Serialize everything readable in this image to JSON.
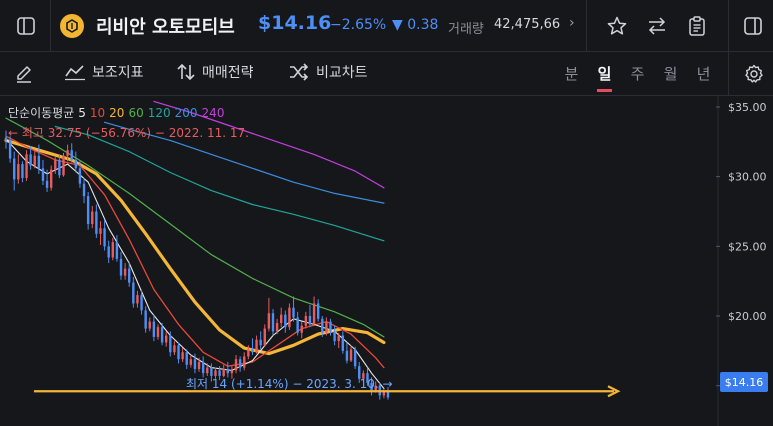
{
  "header": {
    "stock_name": "리비안 오토모티브",
    "price": "$14.16",
    "change_percent": "−2.65%",
    "change_amount": "▼ 0.38",
    "volume_label": "거래량",
    "volume_value": "42,475,66",
    "more_icon": "chevron-right-icon",
    "icons": [
      "sidebar-toggle-icon",
      "star-icon",
      "swap-icon",
      "clipboard-icon",
      "panel-right-icon"
    ]
  },
  "toolbar": {
    "indicator_label": "보조지표",
    "strategy_label": "매매전략",
    "compare_label": "비교차트",
    "periods": [
      "분",
      "일",
      "주",
      "월",
      "년"
    ],
    "active_period": "일"
  },
  "chart_data": {
    "type": "candlestick",
    "y_axis": {
      "ticks": [
        "$35.00",
        "$30.00",
        "$25.00",
        "$20.00",
        "$15.00"
      ],
      "range": [
        13.4,
        35.5
      ]
    },
    "moving_average_legend": {
      "label": "단순이동평균",
      "periods": [
        {
          "value": "5",
          "color": "#e8e8e8"
        },
        {
          "value": "10",
          "color": "#e8493b"
        },
        {
          "value": "20",
          "color": "#f5b637"
        },
        {
          "value": "60",
          "color": "#51b24a"
        },
        {
          "value": "120",
          "color": "#1fa59a"
        },
        {
          "value": "200",
          "color": "#3b8ee0"
        },
        {
          "value": "240",
          "color": "#c43ee0"
        }
      ]
    },
    "high_annotation": "← 최고 32.75 (−56.76%) − 2022. 11. 17.",
    "low_annotation": "최저 14 (+1.14%) − 2023. 3. 10. →",
    "current_price_tag": "$14.16",
    "reference_line_price": 14.6,
    "colors": {
      "up": "#e85c5c",
      "down": "#4d8ff7",
      "reference": "#f5b637"
    },
    "candles_note": "approximate daily OHLC (oldest → newest)",
    "candles": [
      [
        32.8,
        33.3,
        32.0,
        32.6
      ],
      [
        32.6,
        32.9,
        31.0,
        31.3
      ],
      [
        31.3,
        31.8,
        29.0,
        29.8
      ],
      [
        29.8,
        31.6,
        29.5,
        30.9
      ],
      [
        30.9,
        31.1,
        29.6,
        29.9
      ],
      [
        29.9,
        31.9,
        29.7,
        31.6
      ],
      [
        31.6,
        32.2,
        30.5,
        30.8
      ],
      [
        30.8,
        31.9,
        30.6,
        31.5
      ],
      [
        31.5,
        32.3,
        30.2,
        30.6
      ],
      [
        30.6,
        31.2,
        29.4,
        29.7
      ],
      [
        29.7,
        30.5,
        28.9,
        29.2
      ],
      [
        29.2,
        30.8,
        29.0,
        30.5
      ],
      [
        30.5,
        31.4,
        30.2,
        31.2
      ],
      [
        31.2,
        31.6,
        29.9,
        30.1
      ],
      [
        30.1,
        31.7,
        30.0,
        31.5
      ],
      [
        31.5,
        32.3,
        31.1,
        31.9
      ],
      [
        31.9,
        32.4,
        31.0,
        31.2
      ],
      [
        31.2,
        31.8,
        30.3,
        30.6
      ],
      [
        30.6,
        31.1,
        29.2,
        29.5
      ],
      [
        29.5,
        29.9,
        28.1,
        28.6
      ],
      [
        28.6,
        28.9,
        26.2,
        26.6
      ],
      [
        26.6,
        27.9,
        26.3,
        27.5
      ],
      [
        27.5,
        28.0,
        25.6,
        25.9
      ],
      [
        25.9,
        26.8,
        25.1,
        26.3
      ],
      [
        26.3,
        26.9,
        24.7,
        25.0
      ],
      [
        25.0,
        25.4,
        23.8,
        24.2
      ],
      [
        24.2,
        25.6,
        24.0,
        25.3
      ],
      [
        25.3,
        25.8,
        23.9,
        24.1
      ],
      [
        24.1,
        24.6,
        22.6,
        22.9
      ],
      [
        22.9,
        23.8,
        22.6,
        23.4
      ],
      [
        23.4,
        23.9,
        22.1,
        22.4
      ],
      [
        22.4,
        22.8,
        20.6,
        20.9
      ],
      [
        20.9,
        21.8,
        20.6,
        21.5
      ],
      [
        21.5,
        21.9,
        20.1,
        20.4
      ],
      [
        20.4,
        20.7,
        18.8,
        19.1
      ],
      [
        19.1,
        19.9,
        18.9,
        19.6
      ],
      [
        19.6,
        20.1,
        18.2,
        18.5
      ],
      [
        18.5,
        19.4,
        18.3,
        19.2
      ],
      [
        19.2,
        19.5,
        17.9,
        18.1
      ],
      [
        18.1,
        18.9,
        17.8,
        18.6
      ],
      [
        18.6,
        18.9,
        17.1,
        17.4
      ],
      [
        17.4,
        18.2,
        17.2,
        17.9
      ],
      [
        17.9,
        18.1,
        16.6,
        16.9
      ],
      [
        16.9,
        17.7,
        16.7,
        17.4
      ],
      [
        17.4,
        17.6,
        16.2,
        16.5
      ],
      [
        16.5,
        17.2,
        16.3,
        16.9
      ],
      [
        16.9,
        17.3,
        15.9,
        16.2
      ],
      [
        16.2,
        17.0,
        16.0,
        16.7
      ],
      [
        16.7,
        17.1,
        15.6,
        15.9
      ],
      [
        15.9,
        16.6,
        15.7,
        16.3
      ],
      [
        16.3,
        16.6,
        15.3,
        15.7
      ],
      [
        15.7,
        16.3,
        15.5,
        16.1
      ],
      [
        16.1,
        16.4,
        15.4,
        15.7
      ],
      [
        15.7,
        16.5,
        15.6,
        16.2
      ],
      [
        16.2,
        16.7,
        15.6,
        15.9
      ],
      [
        15.9,
        16.4,
        15.5,
        16.1
      ],
      [
        16.1,
        17.2,
        15.9,
        16.9
      ],
      [
        16.9,
        17.1,
        16.0,
        16.3
      ],
      [
        16.3,
        17.4,
        16.1,
        17.1
      ],
      [
        17.1,
        17.9,
        16.9,
        17.6
      ],
      [
        17.6,
        18.4,
        17.2,
        17.4
      ],
      [
        17.4,
        18.6,
        17.3,
        18.3
      ],
      [
        18.3,
        18.9,
        17.6,
        17.9
      ],
      [
        17.9,
        19.4,
        17.8,
        19.1
      ],
      [
        19.1,
        21.3,
        18.9,
        20.2
      ],
      [
        20.2,
        20.5,
        18.6,
        18.9
      ],
      [
        18.9,
        19.8,
        18.7,
        19.5
      ],
      [
        19.5,
        20.6,
        19.2,
        20.1
      ],
      [
        20.1,
        20.4,
        18.8,
        19.2
      ],
      [
        19.2,
        20.9,
        19.0,
        20.6
      ],
      [
        20.6,
        21.4,
        19.6,
        19.9
      ],
      [
        19.9,
        20.3,
        18.6,
        18.8
      ],
      [
        18.8,
        19.6,
        18.4,
        19.3
      ],
      [
        19.3,
        20.3,
        19.1,
        20.0
      ],
      [
        20.0,
        20.8,
        19.2,
        19.4
      ],
      [
        19.4,
        21.4,
        19.3,
        20.9
      ],
      [
        20.9,
        21.2,
        19.6,
        19.8
      ],
      [
        19.8,
        20.0,
        18.5,
        18.8
      ],
      [
        18.8,
        19.9,
        18.6,
        19.6
      ],
      [
        19.6,
        19.8,
        18.6,
        18.9
      ],
      [
        18.9,
        19.3,
        17.9,
        18.2
      ],
      [
        18.2,
        18.8,
        17.7,
        18.6
      ],
      [
        18.6,
        18.9,
        17.3,
        17.5
      ],
      [
        17.5,
        18.1,
        16.6,
        16.8
      ],
      [
        16.8,
        17.9,
        16.7,
        17.6
      ],
      [
        17.6,
        17.8,
        16.2,
        16.4
      ],
      [
        16.4,
        16.7,
        15.2,
        15.5
      ],
      [
        15.5,
        16.1,
        15.3,
        15.9
      ],
      [
        15.9,
        16.3,
        15.0,
        15.2
      ],
      [
        15.2,
        15.6,
        14.3,
        14.6
      ],
      [
        14.6,
        15.3,
        14.5,
        15.0
      ],
      [
        15.0,
        15.2,
        14.0,
        14.3
      ],
      [
        14.3,
        14.8,
        14.1,
        14.6
      ],
      [
        14.6,
        14.9,
        14.0,
        14.16
      ]
    ],
    "ma_lines": [
      {
        "period": "20",
        "color": "#f5b637",
        "width": 3.2,
        "points": [
          [
            0,
            32.6
          ],
          [
            8,
            31.9
          ],
          [
            16,
            31.2
          ],
          [
            22,
            30.2
          ],
          [
            28,
            28.3
          ],
          [
            34,
            25.9
          ],
          [
            40,
            23.4
          ],
          [
            46,
            21.0
          ],
          [
            52,
            19.0
          ],
          [
            58,
            17.7
          ],
          [
            64,
            17.3
          ],
          [
            70,
            17.9
          ],
          [
            76,
            18.7
          ],
          [
            82,
            19.1
          ],
          [
            88,
            18.8
          ],
          [
            92,
            18.1
          ]
        ]
      },
      {
        "period": "10",
        "color": "#e8493b",
        "width": 1.3,
        "points": [
          [
            0,
            32.9
          ],
          [
            6,
            32.0
          ],
          [
            12,
            31.2
          ],
          [
            18,
            30.8
          ],
          [
            24,
            28.7
          ],
          [
            30,
            25.5
          ],
          [
            36,
            21.9
          ],
          [
            42,
            19.4
          ],
          [
            48,
            17.4
          ],
          [
            54,
            16.4
          ],
          [
            60,
            16.7
          ],
          [
            66,
            17.9
          ],
          [
            72,
            19.1
          ],
          [
            78,
            19.6
          ],
          [
            84,
            18.7
          ],
          [
            90,
            17.0
          ],
          [
            92,
            16.3
          ]
        ]
      },
      {
        "period": "5",
        "color": "#e8e8e8",
        "width": 1.1,
        "points": [
          [
            0,
            32.7
          ],
          [
            5,
            31.1
          ],
          [
            10,
            30.2
          ],
          [
            15,
            30.9
          ],
          [
            20,
            29.6
          ],
          [
            25,
            26.3
          ],
          [
            30,
            23.8
          ],
          [
            35,
            20.4
          ],
          [
            40,
            18.6
          ],
          [
            45,
            17.2
          ],
          [
            50,
            16.3
          ],
          [
            55,
            16.1
          ],
          [
            60,
            16.8
          ],
          [
            65,
            18.6
          ],
          [
            70,
            19.8
          ],
          [
            75,
            19.4
          ],
          [
            80,
            18.9
          ],
          [
            85,
            17.6
          ],
          [
            89,
            15.9
          ],
          [
            92,
            14.8
          ]
        ]
      },
      {
        "period": "60",
        "color": "#51b24a",
        "width": 1.2,
        "points": [
          [
            0,
            34.2
          ],
          [
            10,
            32.6
          ],
          [
            20,
            30.8
          ],
          [
            30,
            28.8
          ],
          [
            40,
            26.6
          ],
          [
            50,
            24.4
          ],
          [
            60,
            22.7
          ],
          [
            70,
            21.3
          ],
          [
            80,
            20.3
          ],
          [
            87,
            19.4
          ],
          [
            92,
            18.5
          ]
        ]
      },
      {
        "period": "120",
        "color": "#1fa59a",
        "width": 1.2,
        "points": [
          [
            12,
            33.6
          ],
          [
            20,
            33.0
          ],
          [
            30,
            31.8
          ],
          [
            40,
            30.3
          ],
          [
            50,
            29.0
          ],
          [
            60,
            28.0
          ],
          [
            70,
            27.3
          ],
          [
            80,
            26.5
          ],
          [
            92,
            25.4
          ]
        ]
      },
      {
        "period": "200",
        "color": "#3b8ee0",
        "width": 1.2,
        "points": [
          [
            24,
            33.9
          ],
          [
            30,
            33.4
          ],
          [
            40,
            32.6
          ],
          [
            50,
            31.6
          ],
          [
            60,
            30.6
          ],
          [
            70,
            29.6
          ],
          [
            80,
            28.8
          ],
          [
            92,
            28.1
          ]
        ]
      },
      {
        "period": "240",
        "color": "#c43ee0",
        "width": 1.2,
        "points": [
          [
            36,
            35.4
          ],
          [
            45,
            34.6
          ],
          [
            55,
            33.6
          ],
          [
            65,
            32.6
          ],
          [
            75,
            31.6
          ],
          [
            85,
            30.4
          ],
          [
            92,
            29.2
          ]
        ]
      }
    ]
  }
}
